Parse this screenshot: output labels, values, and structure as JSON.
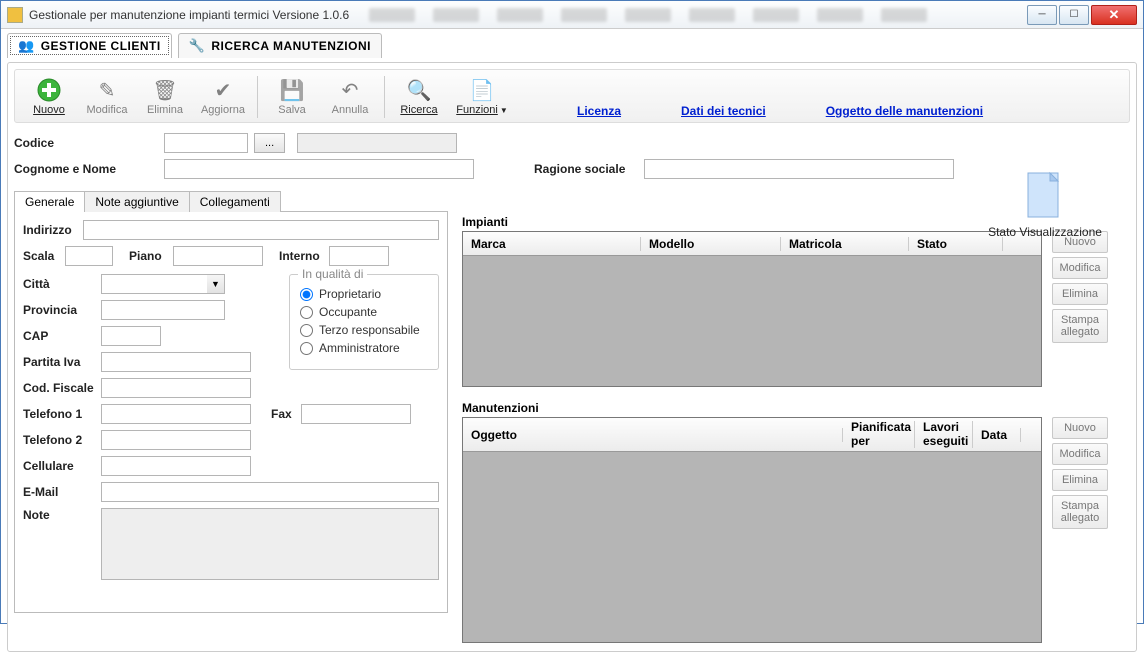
{
  "window": {
    "title": "Gestionale per manutenzione impianti termici Versione 1.0.6"
  },
  "main_tabs": {
    "clients": "GESTIONE CLIENTI",
    "search": "RICERCA MANUTENZIONI"
  },
  "toolbar": {
    "nuovo": "Nuovo",
    "modifica": "Modifica",
    "elimina": "Elimina",
    "aggiorna": "Aggiorna",
    "salva": "Salva",
    "annulla": "Annulla",
    "ricerca": "Ricerca",
    "funzioni": "Funzioni"
  },
  "links": {
    "licenza": "Licenza",
    "dati_tecnici": "Dati dei tecnici",
    "oggetto_manut": "Oggetto delle manutenzioni"
  },
  "labels": {
    "codice": "Codice",
    "cognome_nome": "Cognome e Nome",
    "ragione_sociale": "Ragione sociale",
    "indirizzo": "Indirizzo",
    "scala": "Scala",
    "piano": "Piano",
    "interno": "Interno",
    "citta": "Città",
    "provincia": "Provincia",
    "cap": "CAP",
    "partita_iva": "Partita Iva",
    "cod_fiscale": "Cod. Fiscale",
    "telefono1": "Telefono 1",
    "fax": "Fax",
    "telefono2": "Telefono 2",
    "cellulare": "Cellulare",
    "email": "E-Mail",
    "note": "Note",
    "codice_btn": "...",
    "in_qualita": "In qualità di"
  },
  "subtabs": {
    "generale": "Generale",
    "note_agg": "Note aggiuntive",
    "collegamenti": "Collegamenti"
  },
  "qualita": {
    "proprietario": "Proprietario",
    "occupante": "Occupante",
    "terzo": "Terzo responsabile",
    "amministratore": "Amministratore"
  },
  "impianti": {
    "title": "Impianti",
    "cols": {
      "marca": "Marca",
      "modello": "Modello",
      "matricola": "Matricola",
      "stato": "Stato"
    }
  },
  "manutenzioni": {
    "title": "Manutenzioni",
    "cols": {
      "oggetto": "Oggetto",
      "pianificata": "Pianificata per",
      "lavori": "Lavori eseguiti",
      "data": "Data"
    }
  },
  "sidebuttons": {
    "nuovo": "Nuovo",
    "modifica": "Modifica",
    "elimina": "Elimina",
    "stampa": "Stampa allegato"
  },
  "stato_vis": "Stato Visualizzazione"
}
